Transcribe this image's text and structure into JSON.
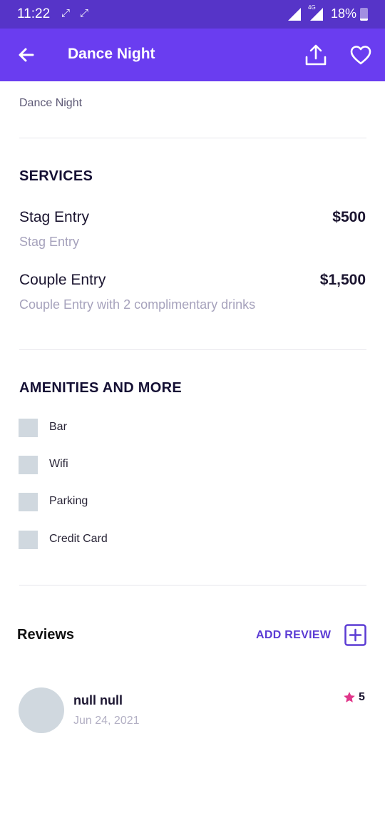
{
  "status_bar": {
    "time": "11:22",
    "network": "4G",
    "battery": "18%",
    "battery_level": 0.18
  },
  "app_bar": {
    "title": "Dance Night",
    "back_icon": "arrow-left-icon",
    "share_icon": "share-upload-icon",
    "favorite_icon": "heart-icon"
  },
  "event": {
    "subtitle": "Dance Night"
  },
  "services": {
    "title": "SERVICES",
    "items": [
      {
        "name": "Stag Entry",
        "price": "$500",
        "description": "Stag Entry"
      },
      {
        "name": "Couple Entry",
        "price": "$1,500",
        "description": "Couple Entry with 2 complimentary drinks"
      }
    ]
  },
  "amenities": {
    "title": "AMENITIES AND MORE",
    "items": [
      {
        "label": "Bar"
      },
      {
        "label": "Wifi"
      },
      {
        "label": "Parking"
      },
      {
        "label": "Credit Card"
      }
    ]
  },
  "reviews": {
    "title": "Reviews",
    "add_label": "ADD REVIEW",
    "items": [
      {
        "name": "null null",
        "date": "Jun 24, 2021",
        "rating": "5"
      }
    ]
  },
  "colors": {
    "status_bar": "#5634c8",
    "app_bar": "#6a3df0",
    "accent": "#5b3bd4",
    "star": "#e0368a",
    "placeholder": "#d0d8df"
  }
}
